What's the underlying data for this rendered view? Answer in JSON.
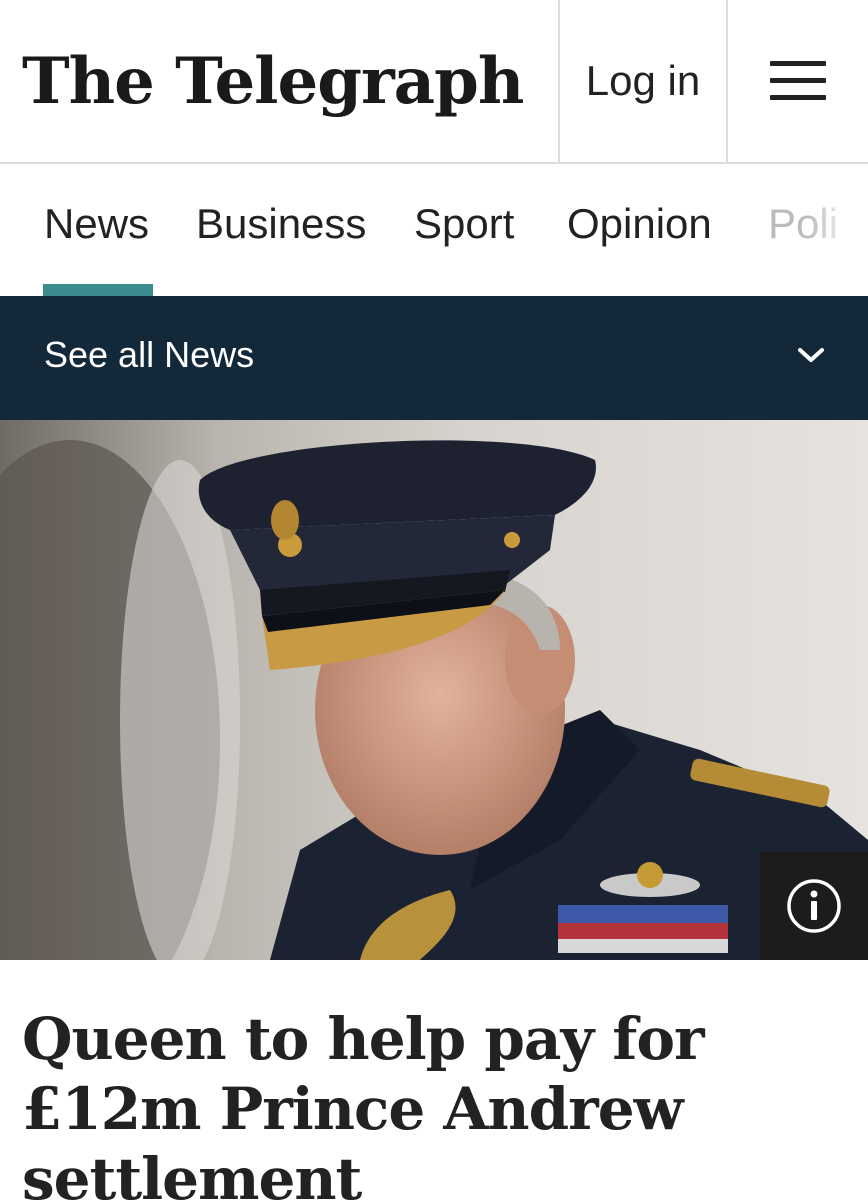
{
  "header": {
    "logo_text": "The Telegraph",
    "login_label": "Log in",
    "menu_icon": "hamburger-menu-icon"
  },
  "nav": {
    "items": [
      {
        "label": "News",
        "active": true
      },
      {
        "label": "Business",
        "active": false
      },
      {
        "label": "Sport",
        "active": false
      },
      {
        "label": "Opinion",
        "active": false
      },
      {
        "label": "Poli",
        "active": false
      }
    ],
    "accent_color": "#3b8c8c"
  },
  "section_bar": {
    "label": "See all News",
    "icon": "chevron-down-icon",
    "background": "#13293a"
  },
  "hero": {
    "description_icon": "info-icon"
  },
  "article": {
    "headline": "Queen to help pay for £12m Prince Andrew settlement"
  }
}
